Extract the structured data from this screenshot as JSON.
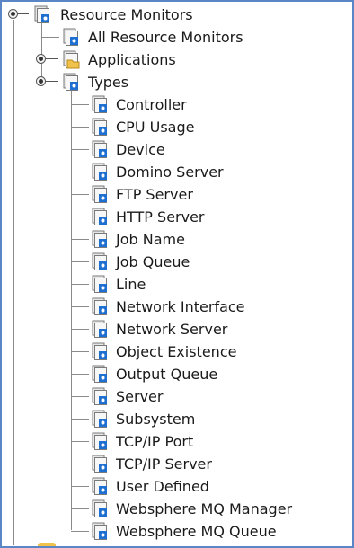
{
  "tree": {
    "root": {
      "label": "Resource Monitors",
      "icon": "resource-monitor-icon"
    },
    "children": [
      {
        "label": "All Resource Monitors",
        "icon": "resource-monitor-icon"
      },
      {
        "label": "Applications",
        "icon": "folder-icon"
      },
      {
        "label": "Types",
        "icon": "resource-monitor-icon"
      }
    ],
    "types": [
      "Controller",
      "CPU Usage",
      "Device",
      "Domino Server",
      "FTP Server",
      "HTTP Server",
      "Job Name",
      "Job Queue",
      "Line",
      "Network Interface",
      "Network Server",
      "Object Existence",
      "Output Queue",
      "Server",
      "Subsystem",
      "TCP/IP Port",
      "TCP/IP Server",
      "User Defined",
      "Websphere MQ Manager",
      "Websphere MQ Queue"
    ]
  },
  "colors": {
    "frame_border": "#5b86c5",
    "icon_blue": "#1f6fd1",
    "folder_yellow": "#f0c24c"
  }
}
